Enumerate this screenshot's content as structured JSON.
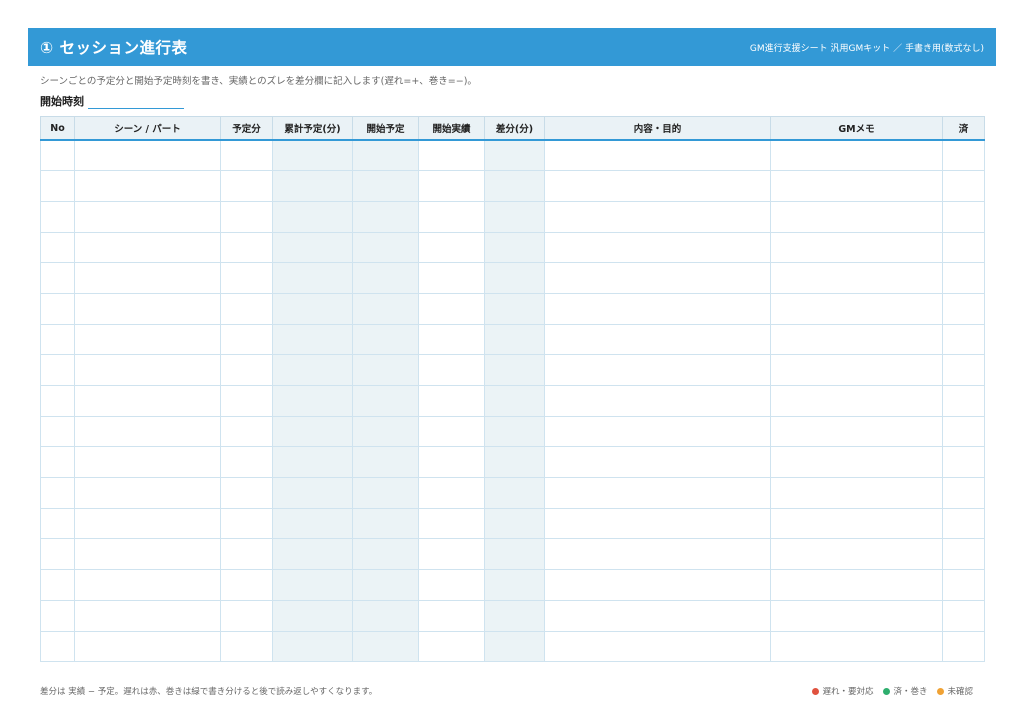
{
  "header": {
    "title": "① セッション進行表",
    "subtitle": "GM進行支援シート 汎用GMキット ／ 手書き用(数式なし)"
  },
  "description": "シーンごとの予定分と開始予定時刻を書き、実績とのズレを差分欄に記入します(遅れ=+、巻き=−)。",
  "start_time": {
    "label": "開始時刻",
    "value": ""
  },
  "table": {
    "columns": [
      "No",
      "シーン / パート",
      "予定分",
      "累計予定(分)",
      "開始予定",
      "開始実績",
      "差分(分)",
      "内容・目的",
      "GMメモ",
      "済"
    ],
    "shaded_columns": [
      3,
      4,
      6
    ],
    "row_count": 17
  },
  "footer": {
    "note": "差分は 実績 − 予定。遅れは赤、巻きは緑で書き分けると後で読み返しやすくなります。",
    "legend": [
      {
        "label": "遅れ・要対応",
        "color": "#e0523f"
      },
      {
        "label": "済・巻き",
        "color": "#2eae6e"
      },
      {
        "label": "未確認",
        "color": "#f0a234"
      }
    ]
  },
  "colors": {
    "accent": "#3399d6",
    "header_bg": "#eaf2f6",
    "shade": "#ebf3f6"
  }
}
